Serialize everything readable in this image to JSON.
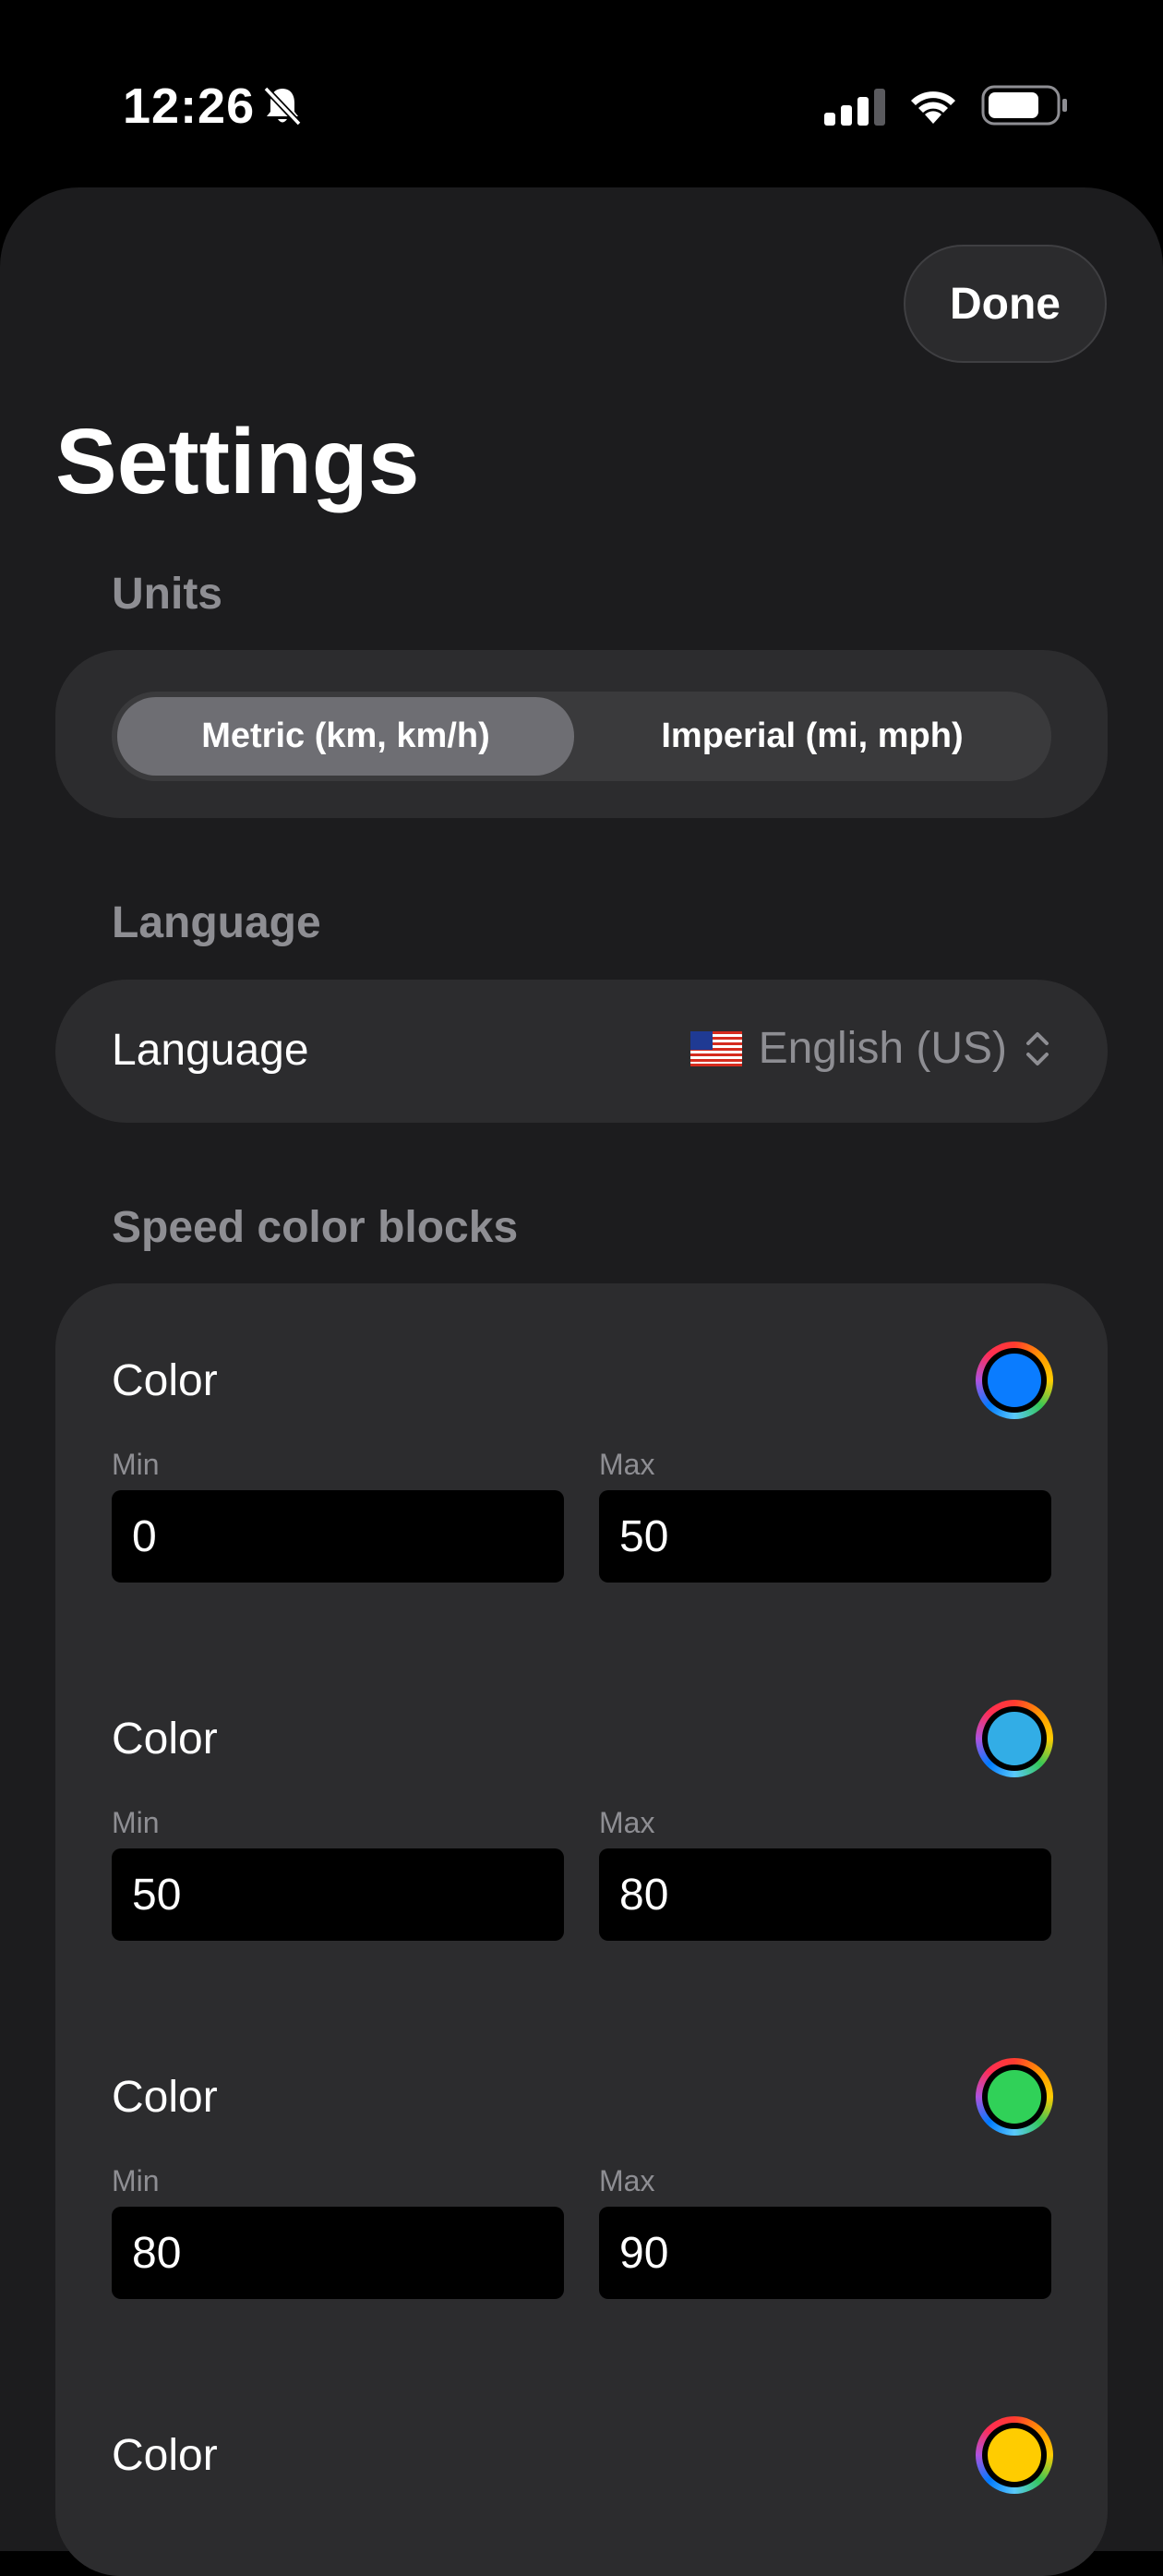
{
  "status_bar": {
    "time": "12:26"
  },
  "header": {
    "done_label": "Done",
    "title": "Settings"
  },
  "units": {
    "header": "Units",
    "options": [
      "Metric (km, km/h)",
      "Imperial (mi, mph)"
    ],
    "selected": "Metric (km, km/h)"
  },
  "language": {
    "header": "Language",
    "row_label": "Language",
    "flag": "🇺🇸",
    "value": "English (US)"
  },
  "speed_blocks": {
    "header": "Speed color blocks",
    "items": [
      {
        "label": "Color",
        "color": "#0a7cff",
        "min_label": "Min",
        "min": "0",
        "max_label": "Max",
        "max": "50"
      },
      {
        "label": "Color",
        "color": "#32ade6",
        "min_label": "Min",
        "min": "50",
        "max_label": "Max",
        "max": "80"
      },
      {
        "label": "Color",
        "color": "#30d158",
        "min_label": "Min",
        "min": "80",
        "max_label": "Max",
        "max": "90"
      },
      {
        "label": "Color",
        "color": "#ffcc00"
      }
    ]
  }
}
